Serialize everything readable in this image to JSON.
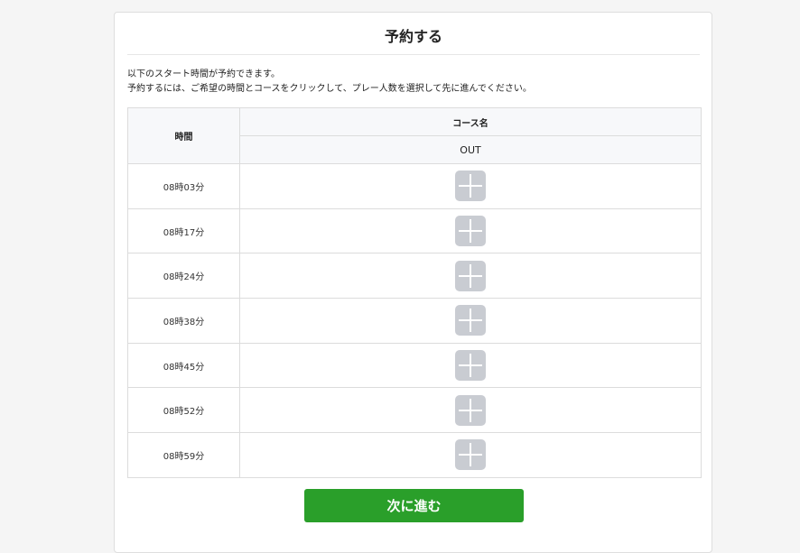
{
  "page": {
    "title": "予約する",
    "intro_line1": "以下のスタート時間が予約できます。",
    "intro_line2": "予約するには、ご希望の時間とコースをクリックして、プレー人数を選択して先に進んでください。"
  },
  "table": {
    "time_header": "時間",
    "course_header": "コース名",
    "course_name": "OUT",
    "rows": [
      {
        "time": "08時03分",
        "action_icon": "plus-icon"
      },
      {
        "time": "08時17分",
        "action_icon": "plus-icon"
      },
      {
        "time": "08時24分",
        "action_icon": "plus-icon"
      },
      {
        "time": "08時38分",
        "action_icon": "plus-icon"
      },
      {
        "time": "08時45分",
        "action_icon": "plus-icon"
      },
      {
        "time": "08時52分",
        "action_icon": "plus-icon"
      },
      {
        "time": "08時59分",
        "action_icon": "plus-icon"
      }
    ]
  },
  "footer": {
    "next_label": "次に進む"
  },
  "colors": {
    "primary_button": "#2a9f2a",
    "add_button": "#c9ccd2",
    "header_bg": "#f7f8fa"
  }
}
